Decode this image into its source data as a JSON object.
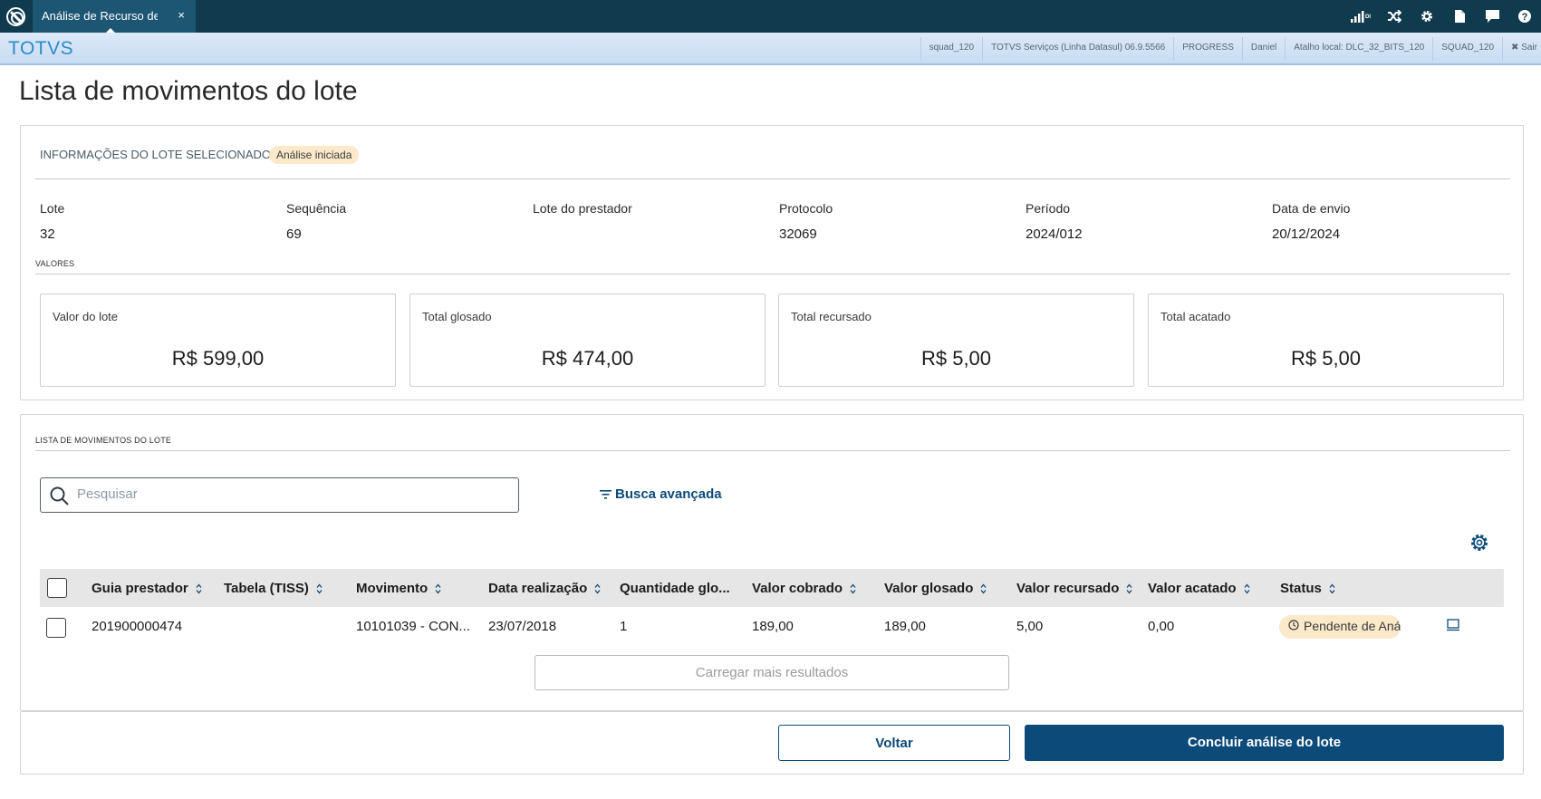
{
  "topbar": {
    "tab_label": "Análise de Recurso de",
    "tab_close": "×",
    "icons": [
      "signal-icon",
      "shuffle-icon",
      "gear-icon",
      "document-icon",
      "chat-icon",
      "help-icon"
    ]
  },
  "infobar": {
    "brand": "TOTVS",
    "items": [
      "squad_120",
      "TOTVS Serviços (Linha Datasul) 06.9.5566",
      "PROGRESS",
      "Daniel",
      "Atalho local: DLC_32_BITS_120",
      "SQUAD_120"
    ],
    "exit_label": "✖ Sair"
  },
  "page": {
    "title": "Lista de movimentos do lote"
  },
  "lote_info": {
    "section_label": "INFORMAÇÕES DO LOTE SELECIONADO",
    "status_badge": "Análise iniciada",
    "fields": [
      {
        "label": "Lote",
        "value": "32"
      },
      {
        "label": "Sequência",
        "value": "69"
      },
      {
        "label": "Lote do prestador",
        "value": ""
      },
      {
        "label": "Protocolo",
        "value": "32069"
      },
      {
        "label": "Período",
        "value": "2024/012"
      },
      {
        "label": "Data de envio",
        "value": "20/12/2024"
      }
    ],
    "valores_label": "VALORES",
    "cards": [
      {
        "label": "Valor do lote",
        "value": "R$ 599,00"
      },
      {
        "label": "Total glosado",
        "value": "R$ 474,00"
      },
      {
        "label": "Total recursado",
        "value": "R$ 5,00"
      },
      {
        "label": "Total acatado",
        "value": "R$ 5,00"
      }
    ]
  },
  "movimentos": {
    "section_label": "LISTA DE MOVIMENTOS DO LOTE",
    "search_placeholder": "Pesquisar",
    "advanced_search_label": "Busca avançada",
    "columns": [
      "Guia prestador",
      "Tabela (TISS)",
      "Movimento",
      "Data realização",
      "Quantidade glo...",
      "Valor cobrado",
      "Valor glosado",
      "Valor recursado",
      "Valor acatado",
      "Status"
    ],
    "rows": [
      {
        "guia_prestador": "201900000474",
        "tabela_tiss": "",
        "movimento": "10101039 - CON...",
        "data_realizacao": "23/07/2018",
        "quantidade_glosada": "1",
        "valor_cobrado": "189,00",
        "valor_glosado": "189,00",
        "valor_recursado": "5,00",
        "valor_acatado": "0,00",
        "status": "Pendente de Análise"
      }
    ],
    "load_more_label": "Carregar mais resultados"
  },
  "footer": {
    "back_label": "Voltar",
    "conclude_label": "Concluir análise do lote"
  },
  "colors": {
    "topbar": "#103a4e",
    "tab": "#1c5673",
    "primary": "#0c4a7a",
    "badge": "#fbe9c9",
    "brand": "#2a8cc9"
  }
}
